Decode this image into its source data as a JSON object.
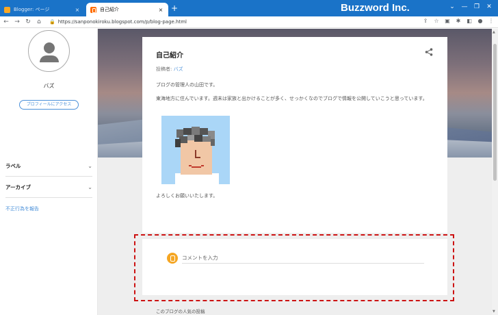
{
  "browser": {
    "tabs": [
      {
        "title": "Blogger: ページ",
        "active": false
      },
      {
        "title": "自己紹介",
        "active": true
      }
    ],
    "new_tab": "+",
    "close_glyph": "×",
    "brand": "Buzzword Inc.",
    "url": "https://sanponokiroku.blogspot.com/p/blog-page.html",
    "accent": "#1a73c8"
  },
  "sidebar": {
    "profile_name": "バズ",
    "profile_button": "プロフィールにアクセス",
    "sections": [
      {
        "label": "ラベル"
      },
      {
        "label": "アーカイブ"
      }
    ],
    "report_link": "不正行為を報告"
  },
  "post": {
    "title": "自己紹介",
    "author_prefix": "投稿者: ",
    "author": "バズ",
    "paragraphs": [
      "ブログの管理人の山田です。",
      "東海地方に住んでいます。週末は家族と出かけることが多く、せっかくなのでブログで情報を公開していこうと思っています。",
      "よろしくお願いいたします。"
    ]
  },
  "comment": {
    "placeholder": "コメントを入力",
    "highlight_color": "#cc1111"
  },
  "footer": {
    "popular_heading": "このブログの人気の投稿"
  }
}
